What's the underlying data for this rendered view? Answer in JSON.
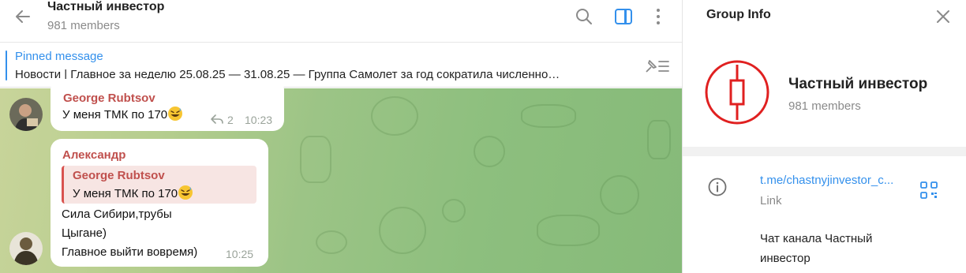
{
  "chat": {
    "title": "Частный инвестор",
    "members": "981 members",
    "icons": [
      "back-arrow-icon",
      "search-icon",
      "sidebar-toggle-icon",
      "more-vertical-icon"
    ],
    "pinned": {
      "label": "Pinned message",
      "text": "Новости | Главное за неделю 25.08.25 — 31.08.25   — Группа Самолет за год сократила численно…"
    },
    "messages": [
      {
        "sender": "George Rubtsov",
        "text": "У меня ТМК по 170",
        "emoji": "grinning-sweat-emoji",
        "replies": "2",
        "time": "10:23"
      },
      {
        "sender": "Александр",
        "quote_sender": "George Rubtsov",
        "quote_text": "У меня ТМК по 170",
        "lines": [
          "Сила Сибири,трубы",
          "Цыгане)",
          "Главное выйти вовремя)"
        ],
        "time": "10:25"
      }
    ]
  },
  "panel": {
    "title": "Group Info",
    "group_name": "Частный инвестор",
    "members": "981 members",
    "link": "t.me/chastnyjinvestor_c...",
    "link_label": "Link",
    "description_lines": [
      "Чат канала Частный",
      "инвестор"
    ]
  },
  "colors": {
    "accent": "#3390ec",
    "sender": "#c0504d",
    "logo_red": "#e02020"
  }
}
